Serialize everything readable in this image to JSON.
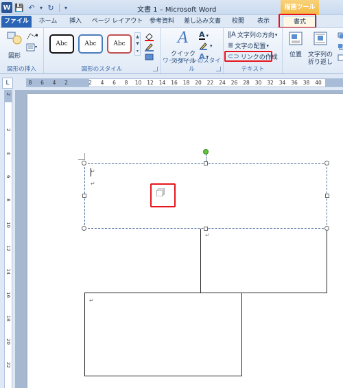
{
  "titlebar": {
    "title": "文書 1 – Microsoft Word",
    "context_label": "描画ツール"
  },
  "qat": {
    "word_glyph": "W",
    "save": "💾",
    "undo": "↶",
    "redo": "↻",
    "more": "▾"
  },
  "tabs": [
    {
      "label": "ファイル"
    },
    {
      "label": "ホーム"
    },
    {
      "label": "挿入"
    },
    {
      "label": "ページ レイアウト"
    },
    {
      "label": "参考資料"
    },
    {
      "label": "差し込み文書"
    },
    {
      "label": "校閲"
    },
    {
      "label": "表示"
    },
    {
      "label": "書式"
    }
  ],
  "ribbon": {
    "insert_shape": {
      "button": "図形",
      "group": "図形の挿入"
    },
    "shape_styles": {
      "swatch": "Abc",
      "group": "図形のスタイル"
    },
    "wordart": {
      "quick_style_1": "クイック",
      "quick_style_2": "スタイル",
      "group": "ワードアートのスタイル"
    },
    "text": {
      "direction": "文字列の方向",
      "align": "文字の配置",
      "link": "リンクの作成",
      "group": "テキスト"
    },
    "arrange": {
      "position": "位置",
      "wrap_1": "文字列の",
      "wrap_2": "折り返し"
    }
  },
  "ruler": {
    "corner": "L",
    "numbers": [
      "8",
      "6",
      "4",
      "2",
      "2",
      "4",
      "6",
      "8",
      "10",
      "12",
      "14",
      "16",
      "18",
      "20",
      "22",
      "24",
      "26",
      "28",
      "30",
      "32",
      "34",
      "36",
      "38",
      "40"
    ],
    "vnumbers": [
      "2",
      "2",
      "4",
      "6",
      "8",
      "10",
      "12",
      "14",
      "16",
      "18",
      "20",
      "22",
      "24"
    ]
  },
  "doc": {
    "para_mark": "↵",
    "cursor_icon": "🗇"
  },
  "colors": {
    "file_tab": "#2a64b4",
    "highlight": "#e8131b",
    "context": "#f4b942",
    "rotate_handle": "#61c43b"
  }
}
